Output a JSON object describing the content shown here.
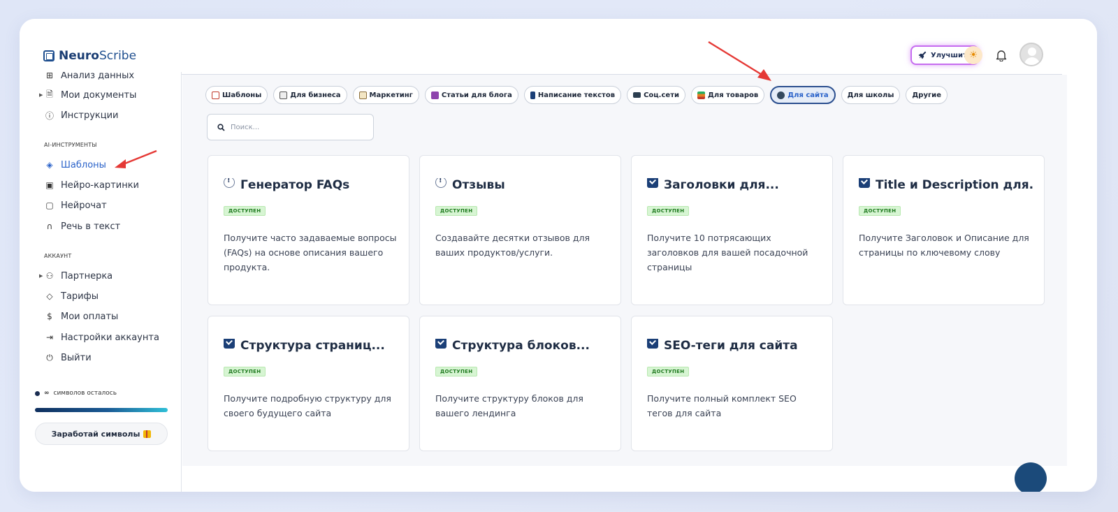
{
  "app": {
    "logo_bold": "Neuro",
    "logo_light": "Scribe"
  },
  "header": {
    "upgrade_label": "Улучшить"
  },
  "sidebar": {
    "items_top": [
      {
        "label": "Анализ данных",
        "icon": "grid-icon"
      },
      {
        "label": "Мои документы",
        "icon": "document-icon"
      },
      {
        "label": "Инструкции",
        "icon": "help-circle-icon"
      }
    ],
    "section_ai": "AI-ИНСТРУМЕНТЫ",
    "items_ai": [
      {
        "label": "Шаблоны",
        "icon": "layers-icon",
        "active": true
      },
      {
        "label": "Нейро-картинки",
        "icon": "image-icon"
      },
      {
        "label": "Нейрочат",
        "icon": "chat-icon"
      },
      {
        "label": "Речь в текст",
        "icon": "headphones-icon"
      }
    ],
    "section_account": "АККАУНТ",
    "items_account": [
      {
        "label": "Партнерка",
        "icon": "users-icon"
      },
      {
        "label": "Тарифы",
        "icon": "tag-icon"
      },
      {
        "label": "Мои оплаты",
        "icon": "dollar-icon"
      },
      {
        "label": "Настройки аккаунта",
        "icon": "login-icon"
      },
      {
        "label": "Выйти",
        "icon": "power-icon"
      }
    ],
    "symbols_label": "символов осталось",
    "symbols_value": "∞",
    "earn_button": "Заработай символы"
  },
  "filters": [
    {
      "label": "Шаблоны",
      "icon_color": "#c0392b"
    },
    {
      "label": "Для бизнеса",
      "icon_color": "#7f8c8d"
    },
    {
      "label": "Маркетинг",
      "icon_color": "#b08d57"
    },
    {
      "label": "Статьи для блога",
      "icon_color": "#8e44ad"
    },
    {
      "label": "Написание текстов",
      "icon_color": "#1b3f77"
    },
    {
      "label": "Соц.сети",
      "icon_color": "#2c3e50"
    },
    {
      "label": "Для товаров",
      "icon_color": "#d35400"
    },
    {
      "label": "Для сайта",
      "icon_color": "#34495e",
      "active": true
    },
    {
      "label": "Для школы"
    },
    {
      "label": "Другие"
    }
  ],
  "search": {
    "placeholder": "Поиск..."
  },
  "cards": [
    {
      "title": "Генератор FAQs",
      "icon": "info-icon",
      "badge": "ДОСТУПЕН",
      "desc": "Получите часто задаваемые вопросы (FAQs) на основе описания вашего продукта."
    },
    {
      "title": "Отзывы",
      "icon": "info-icon",
      "badge": "ДОСТУПЕН",
      "desc": "Создавайте десятки отзывов для ваших продуктов/услуги."
    },
    {
      "title": "Заголовки для...",
      "icon": "check-icon",
      "badge": "ДОСТУПЕН",
      "desc": "Получите 10 потрясающих заголовков для вашей посадочной страницы"
    },
    {
      "title": "Title и Description для...",
      "icon": "check-icon",
      "badge": "ДОСТУПЕН",
      "desc": "Получите Заголовок и Описание для страницы по ключевому слову"
    },
    {
      "title": "Структура страниц...",
      "icon": "check-icon",
      "badge": "ДОСТУПЕН",
      "desc": "Получите подробную структуру для своего будущего сайта"
    },
    {
      "title": "Структура блоков...",
      "icon": "check-icon",
      "badge": "ДОСТУПЕН",
      "desc": "Получите структуру блоков для вашего лендинга"
    },
    {
      "title": "SEO-теги для сайта",
      "icon": "check-icon",
      "badge": "ДОСТУПЕН",
      "desc": "Получите полный комплект SEO тегов для сайта"
    }
  ],
  "colors": {
    "accent": "#2a62c9",
    "annotation_arrow": "#e53935"
  }
}
